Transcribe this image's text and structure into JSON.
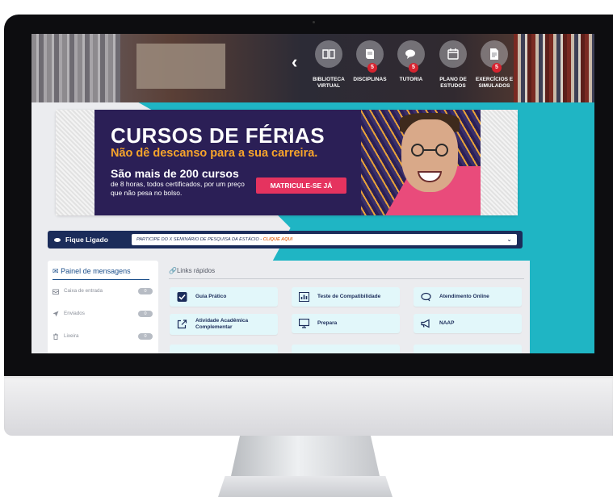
{
  "header": {
    "nav": [
      {
        "label": "BIBLIOTECA VIRTUAL",
        "icon": "book-icon",
        "badge": ""
      },
      {
        "label": "DISCIPLINAS",
        "icon": "books-icon",
        "badge": "5"
      },
      {
        "label": "TUTORIA",
        "icon": "chat-icon",
        "badge": "5"
      },
      {
        "label": "PLANO DE ESTUDOS",
        "icon": "calendar-icon",
        "badge": ""
      },
      {
        "label": "EXERCÍCIOS E SIMULADOS",
        "icon": "document-icon",
        "badge": "5"
      }
    ]
  },
  "banner": {
    "title": "CURSOS DE FÉRIAS",
    "subtitle": "Não dê descanso para a sua carreira.",
    "count": "São mais de 200 cursos",
    "description": "de 8 horas, todos certificados, por um preço que não pesa no bolso.",
    "cta": "MATRICULE-SE JÁ"
  },
  "ticker": {
    "label": "Fique Ligado",
    "text": "PARTICIPE DO X SEMINÁRIO DE PESQUISA DA ESTÁCIO - ",
    "link": "CLIQUE AQUI"
  },
  "messages": {
    "title": "Painel de mensagens",
    "items": [
      {
        "label": "Caixa de entrada",
        "count": "0"
      },
      {
        "label": "Enviados",
        "count": "0"
      },
      {
        "label": "Lixeira",
        "count": "0"
      }
    ]
  },
  "quick_links": {
    "title": "Links rápidos",
    "items": [
      {
        "label": "Guia Prático",
        "icon": "checkbox-icon"
      },
      {
        "label": "Teste de Compatibilidade",
        "icon": "bar-chart-icon"
      },
      {
        "label": "Atendimento Online",
        "icon": "chat-icon"
      },
      {
        "label": "Atividade Acadêmica Complementar",
        "icon": "external-link-icon"
      },
      {
        "label": "Prepara",
        "icon": "monitor-icon"
      },
      {
        "label": "NAAP",
        "icon": "megaphone-icon"
      }
    ]
  },
  "colors": {
    "navy": "#1b2c5a",
    "teal": "#1fb5c4",
    "orange": "#f7a42b",
    "pink": "#e5335f",
    "banner_bg": "#2b1f56"
  }
}
